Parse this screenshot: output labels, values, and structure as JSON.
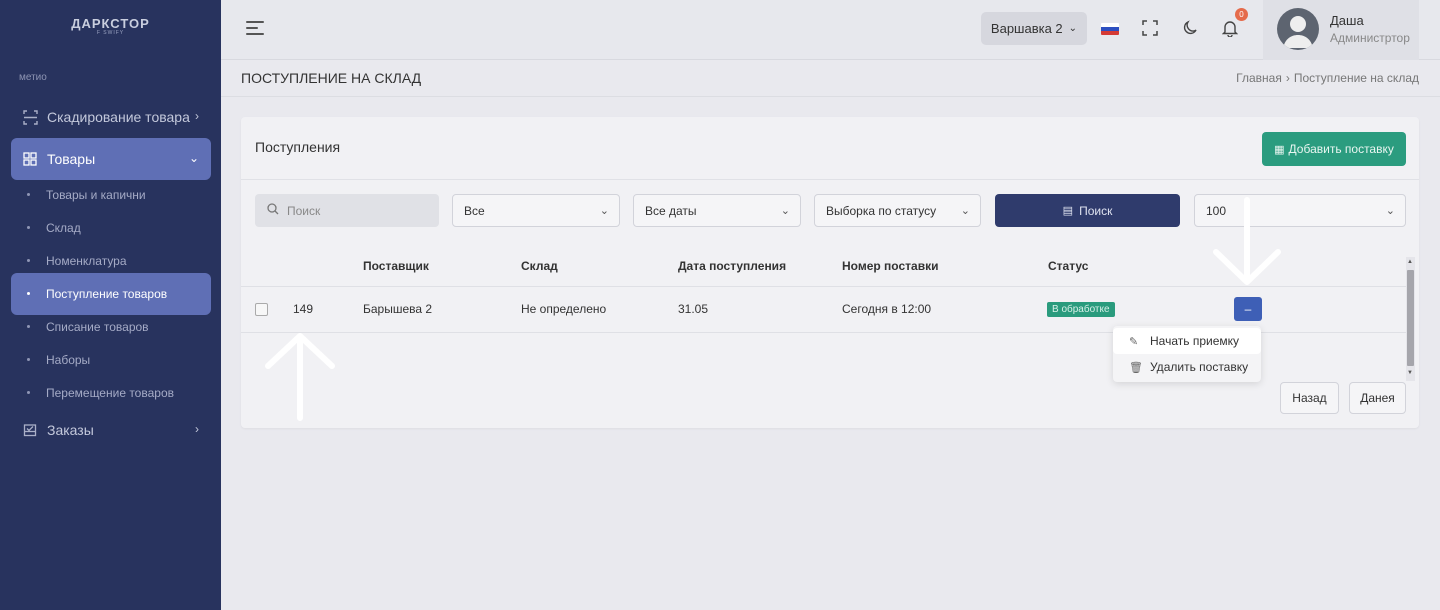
{
  "logo": {
    "title": "ДАРКСТОР",
    "subtitle": "F SWIFY"
  },
  "sidebar": {
    "caption": "метио",
    "items": [
      {
        "label": "Скадирование товара",
        "icon": "scan-icon"
      },
      {
        "label": "Товары",
        "icon": "grid-icon"
      },
      {
        "label": "Заказы",
        "icon": "orders-icon"
      }
    ],
    "subitems": [
      {
        "label": "Товары и капични"
      },
      {
        "label": "Склад"
      },
      {
        "label": "Номенклатура"
      },
      {
        "label": "Поступление товаров"
      },
      {
        "label": "Списание товаров"
      },
      {
        "label": "Наборы"
      },
      {
        "label": "Перемещение товаров"
      }
    ]
  },
  "topbar": {
    "warehouse": "Варшавка 2",
    "notifications": "0",
    "user_name": "Даша",
    "user_role": "Администртор"
  },
  "page": {
    "title": "ПОСТУПЛЕНИЕ НА СКЛАД",
    "breadcrumbs": [
      "Главная",
      "Поступление на склад"
    ]
  },
  "card": {
    "title": "Поступления",
    "add_button": "Добавить поставку"
  },
  "filters": {
    "search_placeholder": "Поиск",
    "type": "Все",
    "dates": "Все даты",
    "status": "Выборка по статусу",
    "search_button": "Поиск",
    "page_size": "100"
  },
  "table": {
    "headers": [
      "Поставщик",
      "Склад",
      "Дата поступления",
      "Номер поставки",
      "Статус"
    ],
    "rows": [
      {
        "id": "149",
        "supplier": "Барышева 2",
        "warehouse": "Не определено",
        "date": "31.05",
        "number": "Сегодня в 12:00",
        "status": "В обработке"
      }
    ]
  },
  "action_menu": {
    "button": "–",
    "items": [
      "Начать приемку",
      "Удалить поставку"
    ]
  },
  "pagination": {
    "prev": "Назад",
    "next": "Данея"
  },
  "colors": {
    "sidebar": "#28335e",
    "accent": "#5f6fb5",
    "green": "#2b9c7f",
    "navy": "#2f3b6c",
    "blue": "#3e5fb6"
  }
}
